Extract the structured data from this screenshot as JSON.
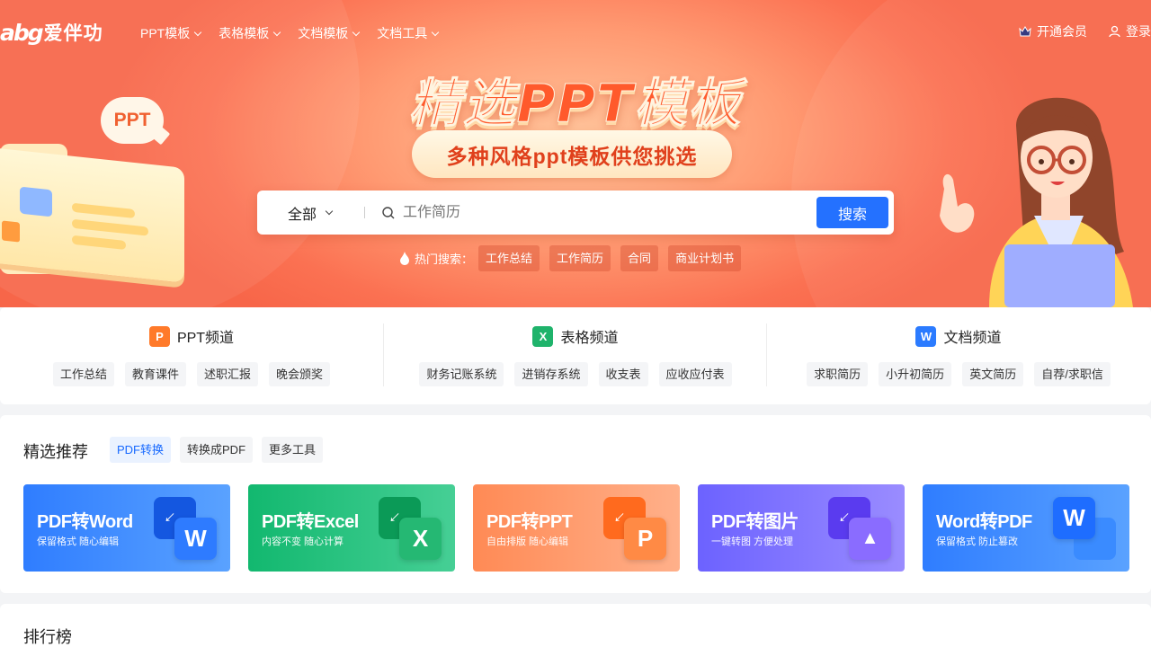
{
  "nav": {
    "logo_en": "abg",
    "logo_cn": "爱伴功",
    "items": [
      {
        "label": "PPT模板"
      },
      {
        "label": "表格模板"
      },
      {
        "label": "文档模板"
      },
      {
        "label": "文档工具"
      }
    ],
    "vip_label": "开通会员",
    "login_label": "登录"
  },
  "hero": {
    "title": "精选PPT模板",
    "subtitle": "多种风格ppt模板供您挑选",
    "bubble_text": "PPT",
    "search": {
      "category": "全部",
      "placeholder": "工作简历",
      "button": "搜索"
    },
    "hot": {
      "label": "热门搜索：",
      "tags": [
        "工作总结",
        "工作简历",
        "合同",
        "商业计划书"
      ]
    }
  },
  "channels": [
    {
      "name": "PPT频道",
      "icon": "ppt-icon",
      "icon_letter": "P",
      "color": "#ff7a2a",
      "tags": [
        "工作总结",
        "教育课件",
        "述职汇报",
        "晚会颁奖"
      ]
    },
    {
      "name": "表格频道",
      "icon": "excel-icon",
      "icon_letter": "X",
      "color": "#1fb36b",
      "tags": [
        "财务记账系统",
        "进销存系统",
        "收支表",
        "应收应付表"
      ]
    },
    {
      "name": "文档频道",
      "icon": "word-icon",
      "icon_letter": "W",
      "color": "#2b7bff",
      "tags": [
        "求职简历",
        "小升初简历",
        "英文简历",
        "自荐/求职信"
      ]
    }
  ],
  "recommend": {
    "title": "精选推荐",
    "tabs": [
      {
        "label": "PDF转换",
        "active": true
      },
      {
        "label": "转换成PDF",
        "active": false
      },
      {
        "label": "更多工具",
        "active": false
      }
    ],
    "cards": [
      {
        "title": "PDF转Word",
        "sub": "保留格式 随心编辑",
        "letter": "W",
        "bg": "linear-gradient(90deg,#2f7dff,#5aa2ff)",
        "back": "#1457e0",
        "front": "#2e7bff"
      },
      {
        "title": "PDF转Excel",
        "sub": "内容不变 随心计算",
        "letter": "X",
        "bg": "linear-gradient(90deg,#12b86f,#46cf95)",
        "back": "#0b9a57",
        "front": "#25b873"
      },
      {
        "title": "PDF转PPT",
        "sub": "自由排版 随心编辑",
        "letter": "P",
        "bg": "linear-gradient(90deg,#ff8a55,#ffb08a)",
        "back": "#ff6a1e",
        "front": "#ff8a45"
      },
      {
        "title": "PDF转图片",
        "sub": "一键转图 方便处理",
        "letter": "▲",
        "bg": "linear-gradient(90deg,#6c62ff,#9a8cff)",
        "back": "#5a3bef",
        "front": "#8a6cff"
      },
      {
        "title": "Word转PDF",
        "sub": "保留格式 防止篡改",
        "letter": "W",
        "bg": "linear-gradient(90deg,#2f7dff,#5aa2ff)",
        "back": "#3a8bff",
        "front": "#1457e0"
      }
    ]
  },
  "ranking": {
    "title": "排行榜"
  },
  "colors": {
    "accent": "#1769ff",
    "hero_orange": "#fb7152"
  }
}
